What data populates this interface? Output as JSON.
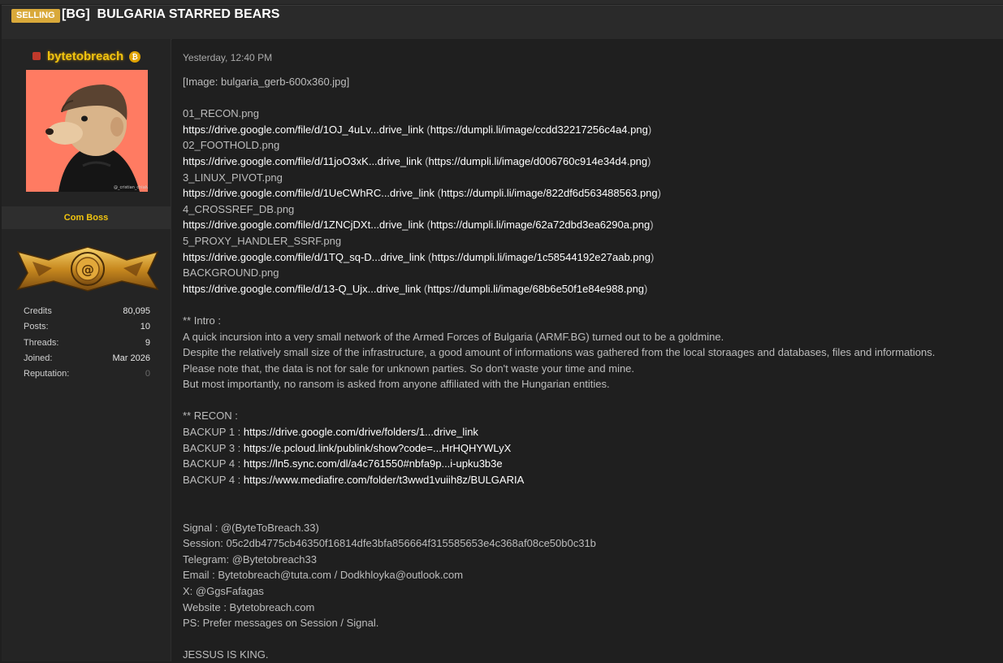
{
  "thread": {
    "badge": "SELLING",
    "title": "[BG]  BULGARIA STARRED BEARS"
  },
  "author": {
    "username": "bytetobreach",
    "coin_icon": "bitcoin-icon",
    "rank": "Com Boss",
    "status_color": "#c0392b",
    "stats": [
      {
        "label": "Credits",
        "value": "80,095"
      },
      {
        "label": "Posts:",
        "value": "10"
      },
      {
        "label": "Threads:",
        "value": "9"
      },
      {
        "label": "Joined:",
        "value": "Mar 2026"
      },
      {
        "label": "Reputation:",
        "value": "0"
      }
    ]
  },
  "post": {
    "date": "Yesterday, 12:40 PM",
    "image_placeholder": "[Image: bulgaria_gerb-600x360.jpg]",
    "files": [
      {
        "name": "01_RECON.png",
        "drive": "https://drive.google.com/file/d/1OJ_4uLv...drive_link",
        "dumpli": "https://dumpli.li/image/ccdd32217256c4a4.png"
      },
      {
        "name": "02_FOOTHOLD.png",
        "drive": "https://drive.google.com/file/d/11joO3xK...drive_link",
        "dumpli": "https://dumpli.li/image/d006760c914e34d4.png"
      },
      {
        "name": "3_LINUX_PIVOT.png",
        "drive": "https://drive.google.com/file/d/1UeCWhRC...drive_link",
        "dumpli": "https://dumpli.li/image/822df6d563488563.png"
      },
      {
        "name": "4_CROSSREF_DB.png",
        "drive": "https://drive.google.com/file/d/1ZNCjDXt...drive_link",
        "dumpli": "https://dumpli.li/image/62a72dbd3ea6290a.png"
      },
      {
        "name": "5_PROXY_HANDLER_SSRF.png",
        "drive": "https://drive.google.com/file/d/1TQ_sq-D...drive_link",
        "dumpli": "https://dumpli.li/image/1c58544192e27aab.png"
      },
      {
        "name": "BACKGROUND.png",
        "drive": "https://drive.google.com/file/d/13-Q_Ujx...drive_link",
        "dumpli": "https://dumpli.li/image/68b6e50f1e84e988.png"
      }
    ],
    "intro_heading": "**  Intro :",
    "intro_lines": [
      "A quick incursion into a very small network of the Armed Forces of Bulgaria (ARMF.BG) turned out to be a goldmine.",
      "Despite the relatively small size of the infrastructure, a good amount of informations was gathered from the local storaages and databases, files and informations.",
      "Please note that, the data is not for sale for unknown parties. So don't waste your time and mine.",
      "But most importantly, no ransom is asked from anyone affiliated with the Hungarian entities."
    ],
    "recon_heading": "** RECON :",
    "backups": [
      {
        "label": "BACKUP 1 : ",
        "url": "https://drive.google.com/drive/folders/1...drive_link"
      },
      {
        "label": "BACKUP 3 : ",
        "url": "https://e.pcloud.link/publink/show?code=...HrHQHYWLyX"
      },
      {
        "label": "BACKUP 4 : ",
        "url": "https://ln5.sync.com/dl/a4c761550#nbfa9p...i-upku3b3e"
      },
      {
        "label": "BACKUP 4 : ",
        "url": "https://www.mediafire.com/folder/t3wwd1vuiih8z/BULGARIA"
      }
    ],
    "contacts": [
      "Signal : @(ByteToBreach.33)",
      "Session: 05c2db4775cb46350f16814dfe3bfa856664f315585653e4c368af08ce50b0c31b",
      "Telegram: @Bytetobreach33",
      "Email : Bytetobreach@tuta.com / Dodkhloyka@outlook.com",
      "X: @GgsFafagas",
      "Website : Bytetobreach.com",
      "PS: Prefer messages on Session / Signal."
    ],
    "signoff": "JESSUS IS KING."
  }
}
